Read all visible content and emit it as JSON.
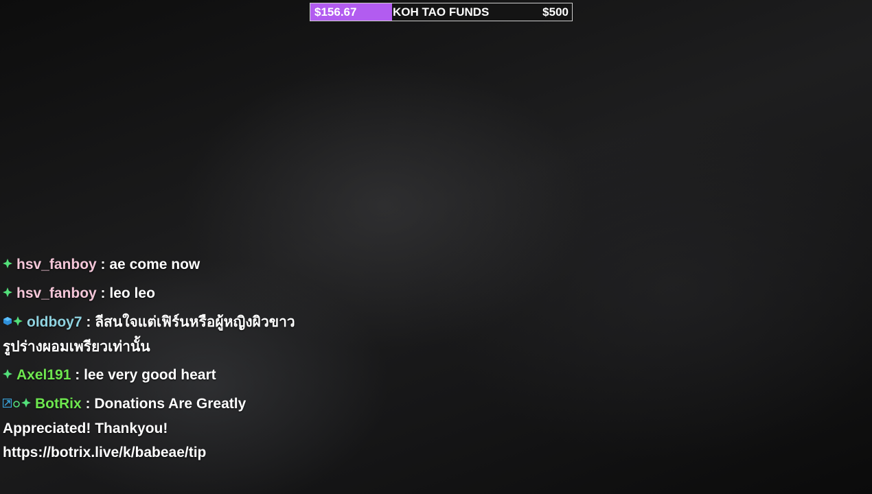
{
  "goal": {
    "current": "$156.67",
    "title": "KOH TAO FUNDS",
    "target": "$500",
    "progress": 0.3133,
    "fill_color": "#b25cf0"
  },
  "chat": {
    "separator": " : ",
    "messages": [
      {
        "user": "hsv_fanboy",
        "user_color": "#f4c6d8",
        "badges": [
          "subscriber-badge-icon"
        ],
        "text": "ae come now"
      },
      {
        "user": "hsv_fanboy",
        "user_color": "#f4c6d8",
        "badges": [
          "subscriber-badge-icon"
        ],
        "text": "leo leo"
      },
      {
        "user": "oldboy7",
        "user_color": "#8fd3e0",
        "badges": [
          "gift-badge-icon",
          "subscriber-badge-icon"
        ],
        "text": "ลีสนใจแต่เฟิร์นหรือผู้หญิงผิวขาวรูปร่างผอมเพรียวเท่านั้น"
      },
      {
        "user": "Axel191",
        "user_color": "#6ee64f",
        "badges": [
          "subscriber-badge-icon"
        ],
        "text": "lee very good heart"
      },
      {
        "user": "BotRix",
        "user_color": "#6ee64f",
        "badges": [
          "bot-badge-icon",
          "verified-badge-icon",
          "subscriber-badge-icon"
        ],
        "text": "Donations Are Greatly Appreciated! Thankyou! https://botrix.live/k/babeae/tip"
      }
    ]
  }
}
